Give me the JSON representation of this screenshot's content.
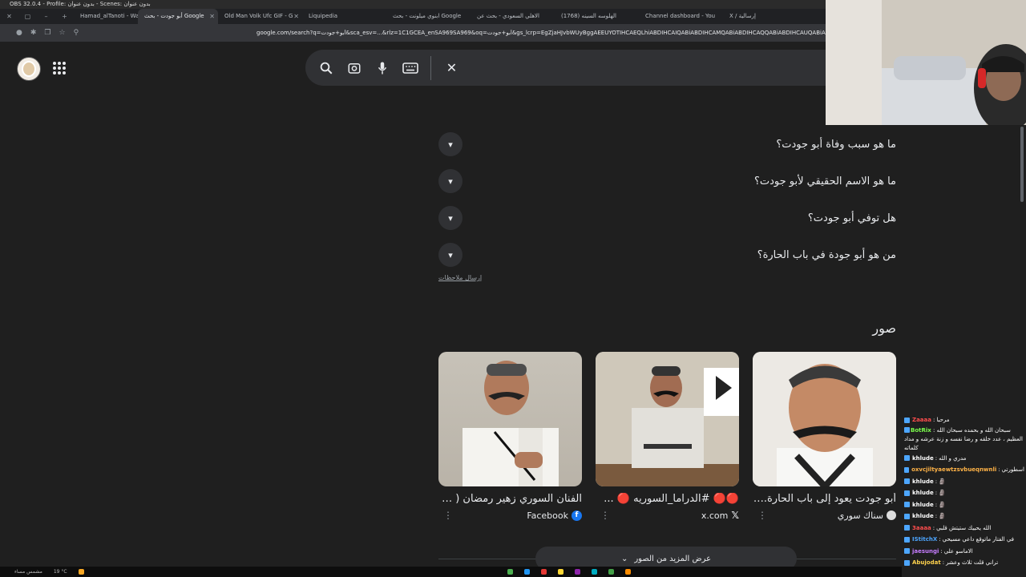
{
  "obs": {
    "title": "OBS 32.0.4 - Profile: بدون عنوان - Scenes: بدون عنوان"
  },
  "tabs": [
    {
      "label": "أبو جودت - بحث Google",
      "active": true
    },
    {
      "label": "Hamad_alTanoti - Watch"
    },
    {
      "label": "Old Man Volk Ufc GIF - G"
    },
    {
      "label": "Liquipedia"
    },
    {
      "label": "ابنوي ميلونت - بحث Google"
    },
    {
      "label": "الاهلي السعودي - بحث عن"
    },
    {
      "label": "(1768) الهلوسه السينه"
    },
    {
      "label": "Channel dashboard - You"
    },
    {
      "label": "X / إرسالية"
    }
  ],
  "address": {
    "url": "google.com/search?q=أبو+جودت&sca_esv=...&rlz=1C1GCEA_enSA969SA969&oq=أبو+جودت&gs_lcrp=EgZjaHJvbWUyBggAEEUYOTIHCAEQLhiABDIHCAIQABiABDIHCAMQABiABDIHCAQQABiABDIHCAUQABiABDIHCAYQABiABDIGCAcQRRg90gEI"
  },
  "search": {
    "query": ""
  },
  "paa": {
    "items": [
      "ما هو سبب وفاة أبو جودت؟",
      "ما هو الاسم الحقيقي لأبو جودت؟",
      "هل توفي أبو جودت؟",
      "من هو أبو جودة في باب الحارة؟"
    ],
    "feedback": "إرسال ملاحظات"
  },
  "images": {
    "heading": "صور",
    "cards": [
      {
        "title": "أبو جودت يعود إلى باب الحارة..لمخ...",
        "source": "سناك سوري"
      },
      {
        "title": "🔴🔴 #الدراما_السوريه 🔴 ...",
        "source": "x.com"
      },
      {
        "title": "الفنان السوري زهير رمضان ( صا...",
        "source": "Facebook"
      }
    ],
    "more": "عرض المزيد من الصور"
  },
  "chat": {
    "messages": [
      {
        "user": "Zaaaa",
        "text": "مرحبا",
        "color": "#ff4d4d"
      },
      {
        "user": "BotRix",
        "text": "سبحان الله و بحمده سبحان الله العظيم ، عدد خلقه و رضا نفسه و زنة عرشه و مداد كلماته",
        "color": "#7cff4d"
      },
      {
        "user": "khlude",
        "text": "مدري و الله",
        "color": "#ffffff"
      },
      {
        "user": "oxvcjiltyaewtzsvbueqnwnli",
        "text": "اسطورتي",
        "color": "#ffb347"
      },
      {
        "user": "khlude",
        "text": "🗿",
        "color": "#ffffff"
      },
      {
        "user": "khlude",
        "text": "🗿",
        "color": "#ffffff"
      },
      {
        "user": "khlude",
        "text": "🗿",
        "color": "#ffffff"
      },
      {
        "user": "khlude",
        "text": "🗿",
        "color": "#ffffff"
      },
      {
        "user": "3aaaa",
        "text": "الله يحييك ستيتش قلبي",
        "color": "#ff4d4d"
      },
      {
        "user": "IStitchX",
        "text": "في الفتار ماتوقع داعي مسيحي",
        "color": "#4da6ff"
      },
      {
        "user": "jaesungi",
        "text": "الاماسو علي",
        "color": "#c77dff"
      },
      {
        "user": "Abujodat",
        "text": "تراني قلت ثلاث وعشر",
        "color": "#ffd24d"
      }
    ]
  },
  "taskbar": {
    "weather": "19 °C",
    "label": "مشمس مساء"
  }
}
